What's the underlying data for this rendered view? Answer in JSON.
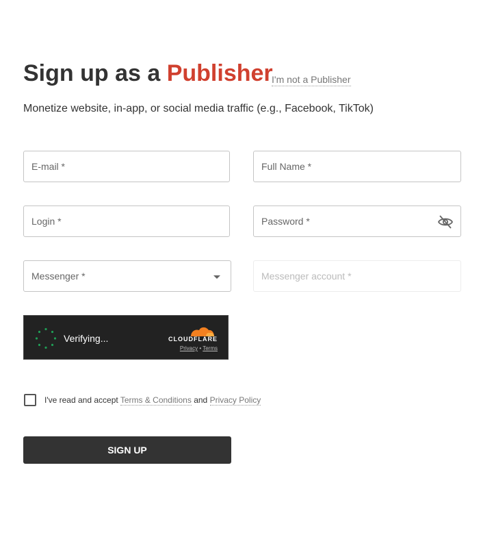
{
  "header": {
    "title_prefix": "Sign up as a ",
    "title_accent": "Publisher",
    "not_link": "I'm not a Publisher",
    "subtitle": "Monetize website, in-app, or social media traffic (e.g., Facebook, TikTok)"
  },
  "form": {
    "email_placeholder": "E-mail *",
    "fullname_placeholder": "Full Name *",
    "login_placeholder": "Login *",
    "password_placeholder": "Password *",
    "messenger_placeholder": "Messenger *",
    "messenger_account_placeholder": "Messenger account *"
  },
  "captcha": {
    "status": "Verifying...",
    "brand": "CLOUDFLARE",
    "privacy": "Privacy",
    "separator": "•",
    "terms": "Terms"
  },
  "agreement": {
    "prefix": "I've read and accept ",
    "terms_link": "Terms & Conditions",
    "and": " and ",
    "privacy_link": "Privacy Policy"
  },
  "submit": {
    "label": "SIGN UP"
  },
  "colors": {
    "accent": "#d0402f",
    "button": "#333333",
    "cloudflare_orange": "#f38020",
    "spinner": "#1f9d55"
  },
  "icons": {
    "password_toggle": "eye-off-icon",
    "select_caret": "caret-down-icon"
  }
}
